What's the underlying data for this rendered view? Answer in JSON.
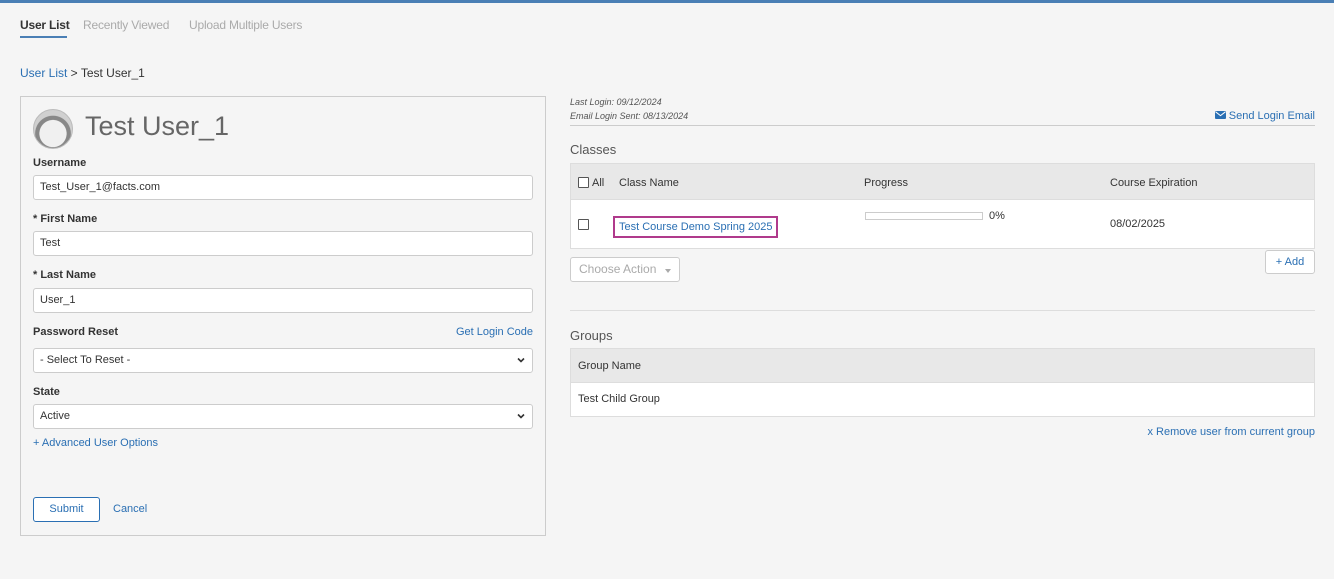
{
  "tabs": [
    {
      "label": "User List",
      "active": true
    },
    {
      "label": "Recently Viewed",
      "active": false
    },
    {
      "label": "Upload Multiple Users",
      "active": false
    }
  ],
  "breadcrumb": {
    "root": "User List",
    "separator": " > ",
    "current": "Test User_1"
  },
  "user_form": {
    "name": "Test User_1",
    "username_label": "Username",
    "username_value": "Test_User_1@facts.com",
    "first_name_label": "* First Name",
    "first_name_value": "Test",
    "last_name_label": "* Last Name",
    "last_name_value": "User_1",
    "password_reset_label": "Password Reset",
    "get_login_code": "Get Login Code",
    "password_reset_value": "- Select To Reset -",
    "state_label": "State",
    "state_value": "Active",
    "advanced_options": "+ Advanced User Options",
    "submit": "Submit",
    "cancel": "Cancel"
  },
  "meta": {
    "last_login": "Last Login: 09/12/2024",
    "email_sent": "Email Login Sent: 08/13/2024",
    "send_login_email": "Send Login Email"
  },
  "classes": {
    "title": "Classes",
    "all_label": "All",
    "columns": [
      "Class Name",
      "Progress",
      "Course Expiration"
    ],
    "rows": [
      {
        "class_name": "Test Course Demo Spring 2025",
        "progress": 0,
        "progress_label": "0%",
        "expiration": "08/02/2025"
      }
    ],
    "choose_action": "Choose Action",
    "add": "+ Add"
  },
  "groups": {
    "title": "Groups",
    "column": "Group Name",
    "rows": [
      {
        "name": "Test Child Group"
      }
    ],
    "remove": "x Remove user from current group"
  },
  "colors": {
    "accent": "#2a6fb3",
    "topbar": "#4a7fb5",
    "highlight": "#b03a8c"
  },
  "icons": {
    "envelope": "envelope-icon",
    "chevron": "chevron-down-icon",
    "avatar": "user-avatar"
  }
}
